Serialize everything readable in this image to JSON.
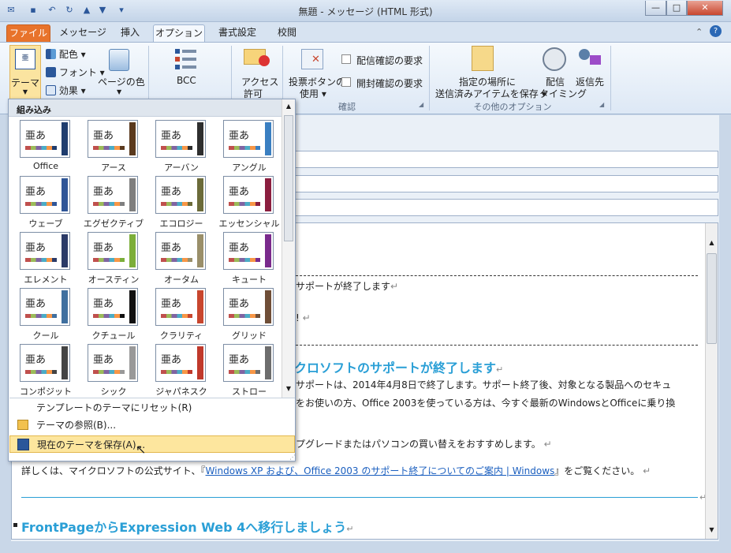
{
  "window": {
    "title": "無題 - メッセージ (HTML 形式)"
  },
  "tabs": [
    "ファイル",
    "メッセージ",
    "挿入",
    "オプション",
    "書式設定",
    "校閲"
  ],
  "ribbon": {
    "theme_label": "テーマ",
    "colors_label": "配色",
    "fonts_label": "フォント",
    "effects_label": "効果",
    "page_color_label": "ページの色",
    "bcc_label": "BCC",
    "access_label": "アクセス",
    "permission_label": "許可",
    "voting_label": "投票ボタンの",
    "use_label": "使用",
    "delivery_receipt": "配信確認の要求",
    "read_receipt": "開封確認の要求",
    "group_tracking": "確認",
    "save_sent_line1": "指定の場所に",
    "save_sent_line2": "送信済みアイテムを保存",
    "delay_line1": "配信",
    "delay_line2": "タイミング",
    "reply_to": "返信先",
    "group_more": "その他のオプション"
  },
  "gallery": {
    "header": "組み込み",
    "themes": [
      "Office",
      "アース",
      "アーバン",
      "アングル",
      "ウェーブ",
      "エグゼクティブ",
      "エコロジー",
      "エッセンシャル",
      "エレメント",
      "オースティン",
      "オータム",
      "キュート",
      "クール",
      "クチュール",
      "クラリティ",
      "グリッド",
      "コンポジット",
      "シック",
      "ジャパネスク",
      "ストロー"
    ],
    "thumb_text": "亜あ",
    "menu": [
      "テンプレートのテーマにリセット(R)",
      "テーマの参照(B)...",
      "現在のテーマを保存(A)..."
    ]
  },
  "body": {
    "line1": "サポートが終了します",
    "line2": "!",
    "heading1": "クロソフトのサポートが終了します",
    "para1a": "サポートは、2014年4月8日で終了します。サポート終了後、対象となる製品へのセキュ",
    "para1b": "をお使いの方、Office 2003を使っている方は、今すぐ最新のWindowsとOfficeに乗り換",
    "para2": "プグレードまたはパソコンの買い替えをおすすめします。",
    "para3_pre": "詳しくは、マイクロソフトの公式サイト、『",
    "para3_link": "Windows XP および、Office 2003 のサポート終了についてのご案内 | Windows",
    "para3_post": "』をご覧ください。",
    "heading2": "FrontPageからExpression Web 4へ移行しましょう"
  },
  "colors": {
    "accent": "#2a9fd6",
    "file_tab": "#e8732b"
  }
}
